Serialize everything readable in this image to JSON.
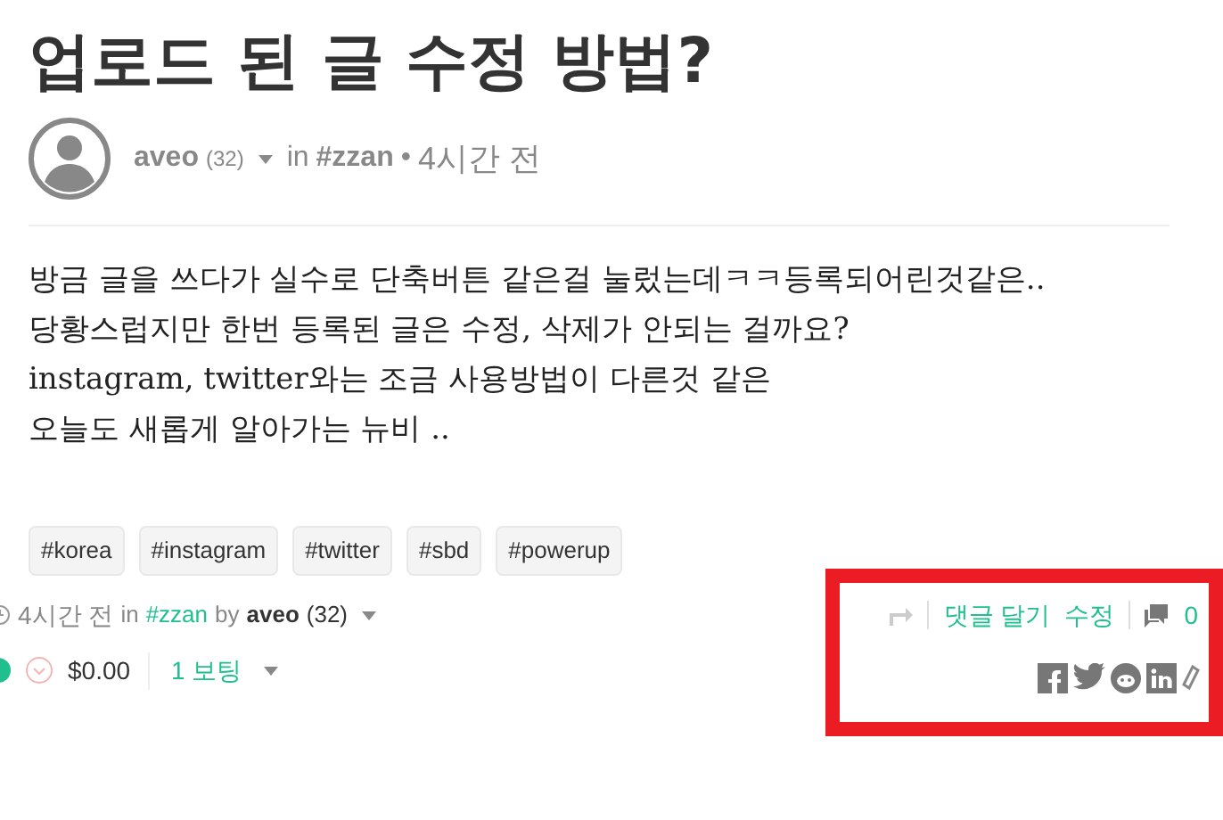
{
  "title": "업로드 된 글 수정 방법?",
  "author": {
    "name": "aveo",
    "reputation": "(32)",
    "in_label": "in",
    "community": "#zzan",
    "separator": "•",
    "time": "4시간 전"
  },
  "body": [
    "방금 글을 쓰다가 실수로 단축버튼 같은걸 눌렀는데ㅋㅋ등록되어린것같은..",
    "당황스럽지만 한번 등록된 글은 수정, 삭제가 안되는 걸까요?",
    "instagram, twitter와는 조금 사용방법이 다른것 같은",
    "오늘도 새롭게 알아가는 뉴비 .."
  ],
  "tags": [
    "#korea",
    "#instagram",
    "#twitter",
    "#sbd",
    "#powerup"
  ],
  "footer": {
    "time": "4시간 전",
    "in_label": "in",
    "community": "#zzan",
    "by_label": "by",
    "author": "aveo",
    "reputation": "(32)",
    "reply": "댓글 달기",
    "edit": "수정",
    "comments": "0"
  },
  "payout": {
    "amount": "$0.00",
    "votes": "1 보팅"
  }
}
